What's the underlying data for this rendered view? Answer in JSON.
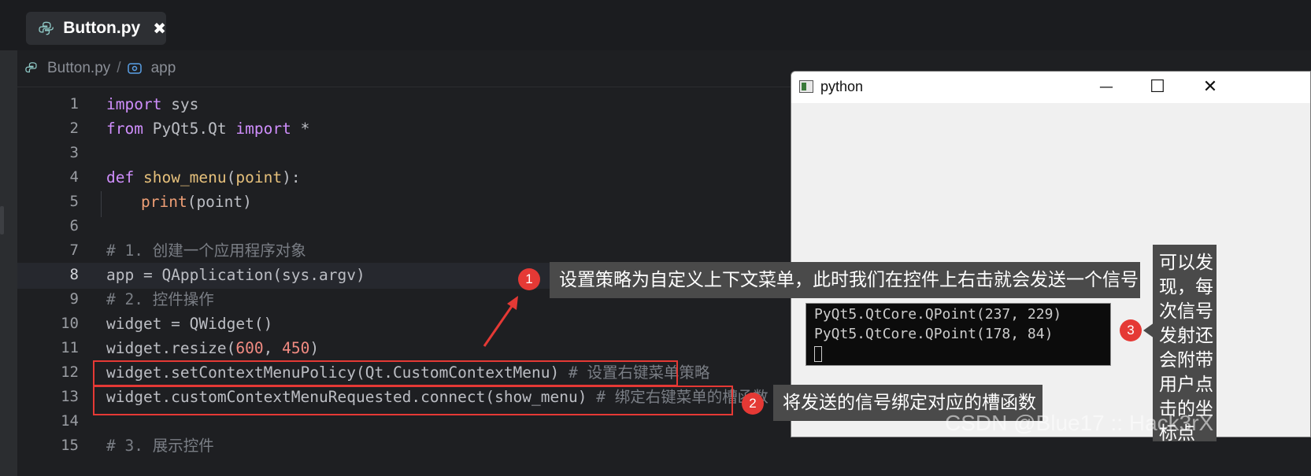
{
  "tab": {
    "name": "Button.py",
    "close": "✖"
  },
  "breadcrumb": {
    "file": "Button.py",
    "sep": "/",
    "symbol": "app"
  },
  "code_lines": [
    {
      "n": "1"
    },
    {
      "n": "2"
    },
    {
      "n": "3"
    },
    {
      "n": "4"
    },
    {
      "n": "5"
    },
    {
      "n": "6"
    },
    {
      "n": "7"
    },
    {
      "n": "8"
    },
    {
      "n": "9"
    },
    {
      "n": "10"
    },
    {
      "n": "11"
    },
    {
      "n": "12"
    },
    {
      "n": "13"
    },
    {
      "n": "14"
    },
    {
      "n": "15"
    }
  ],
  "code": {
    "l1": {
      "kw": "import",
      "rest": " sys"
    },
    "l2": {
      "kw1": "from",
      "mid": " PyQt5.Qt ",
      "kw2": "import",
      "rest": " *"
    },
    "l4": {
      "kw": "def",
      "name": "show_menu",
      "open": "(",
      "param": "point",
      "close": "):"
    },
    "l5": {
      "fn": "print",
      "rest": "(point)"
    },
    "l7": "# 1. 创建一个应用程序对象",
    "l8": "app = QApplication(sys.argv)",
    "l9": "# 2. 控件操作",
    "l10": "widget = QWidget()",
    "l11": {
      "pre": "widget.resize(",
      "n1": "600",
      "mid": ", ",
      "n2": "450",
      "post": ")"
    },
    "l12": {
      "code": "widget.setContextMenuPolicy(Qt.CustomContextMenu) ",
      "comment": "# 设置右键菜单策略"
    },
    "l13": {
      "code": "widget.customContextMenuRequested.connect(show_menu) ",
      "comment": "# 绑定右键菜单的槽函数"
    },
    "l15": "# 3. 展示控件"
  },
  "annotations": {
    "badge1": "1",
    "callout1": "设置策略为自定义上下文菜单，此时我们在控件上右击就会发送一个信号",
    "badge2": "2",
    "callout2": "将发送的信号绑定对应的槽函数",
    "badge3": "3",
    "callout3": "可以发现，每次信号发射还会附带用户点击的坐标点"
  },
  "python_window": {
    "title": "python",
    "minimize": "—",
    "maximize": "☐",
    "close": "✕",
    "console_lines": [
      "PyQt5.QtCore.QPoint(237, 229)",
      "PyQt5.QtCore.QPoint(178, 84)"
    ]
  },
  "watermark": "CSDN @Blue17 :: Hack3rX",
  "colors": {
    "accent_red": "#e53935",
    "editor_bg": "#1e1f22",
    "callout_bg": "#4a4a4a"
  }
}
